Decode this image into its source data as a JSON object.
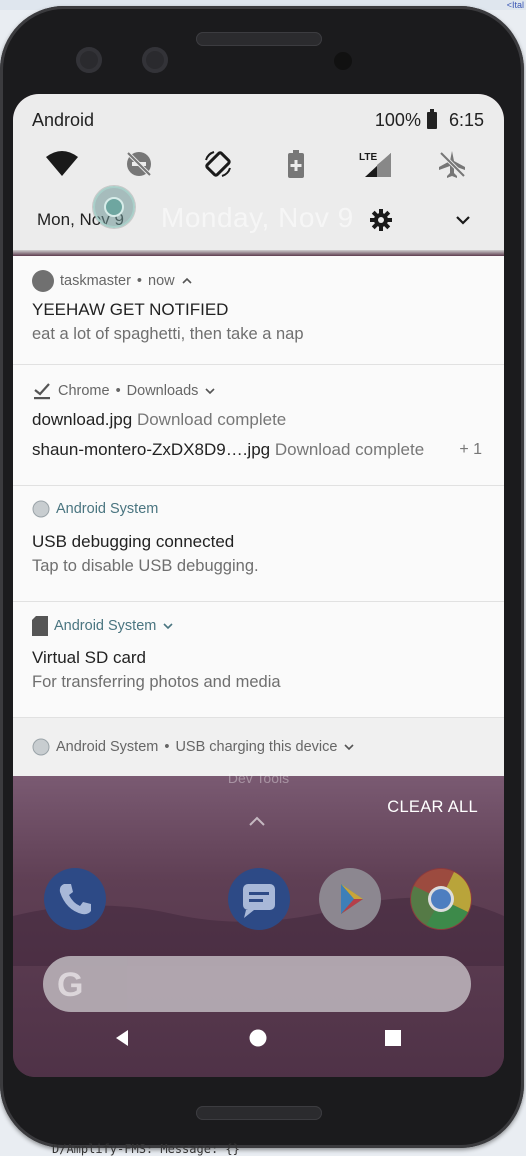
{
  "background": {
    "log_line": "D/Amplify-FMS: Message: {}",
    "side_text": "<Ital"
  },
  "status_bar": {
    "label": "Android",
    "battery": "100%",
    "time": "6:15"
  },
  "quick_settings": {
    "tiles": [
      {
        "name": "wifi-icon"
      },
      {
        "name": "do-not-disturb-off-icon"
      },
      {
        "name": "auto-rotate-icon"
      },
      {
        "name": "battery-saver-icon"
      },
      {
        "name": "mobile-data-lte-icon",
        "badge": "LTE"
      },
      {
        "name": "airplane-mode-off-icon"
      }
    ],
    "date": "Mon, Nov 9",
    "date_ghost": "Monday, Nov 9"
  },
  "notifications": [
    {
      "app": "taskmaster",
      "time": "now",
      "title": "YEEHAW GET NOTIFIED",
      "body": "eat a lot of spaghetti, then take a nap"
    },
    {
      "app": "Chrome",
      "subtext": "Downloads",
      "line1_name": "download.jpg",
      "line1_status": "Download complete",
      "line2_name": "shaun-montero-ZxDX8D9….jpg",
      "line2_status": "Download complete",
      "extra_count": "+ 1"
    },
    {
      "app": "Android System",
      "title": "USB debugging connected",
      "body": "Tap to disable USB debugging."
    },
    {
      "app": "Android System",
      "title": "Virtual SD card",
      "body": "For transferring photos and media"
    },
    {
      "app": "Android System",
      "subtext": "USB charging this device"
    }
  ],
  "home": {
    "folder_label": "Dev Tools",
    "clear_all": "CLEAR ALL",
    "search_logo": "G"
  },
  "colors": {
    "accent_teal": "#4a7580",
    "shade_bg": "#ececec",
    "wallpaper": "#5f3f54"
  }
}
